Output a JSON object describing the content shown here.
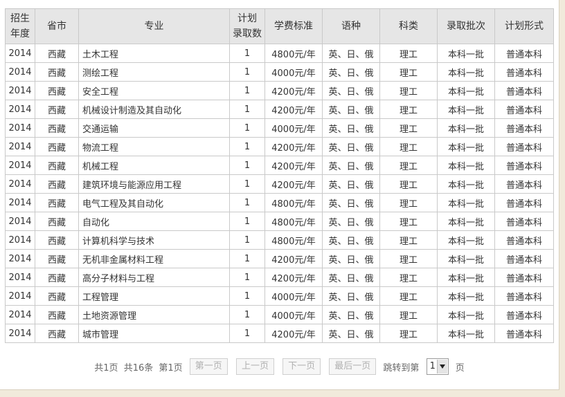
{
  "columns": [
    "招生\n年度",
    "省市",
    "专业",
    "计划\n录取数",
    "学费标准",
    "语种",
    "科类",
    "录取批次",
    "计划形式"
  ],
  "rows": [
    [
      "2014",
      "西藏",
      "土木工程",
      "1",
      "4800元/年",
      "英、日、俄",
      "理工",
      "本科一批",
      "普通本科"
    ],
    [
      "2014",
      "西藏",
      "测绘工程",
      "1",
      "4000元/年",
      "英、日、俄",
      "理工",
      "本科一批",
      "普通本科"
    ],
    [
      "2014",
      "西藏",
      "安全工程",
      "1",
      "4200元/年",
      "英、日、俄",
      "理工",
      "本科一批",
      "普通本科"
    ],
    [
      "2014",
      "西藏",
      "机械设计制造及其自动化",
      "1",
      "4200元/年",
      "英、日、俄",
      "理工",
      "本科一批",
      "普通本科"
    ],
    [
      "2014",
      "西藏",
      "交通运输",
      "1",
      "4000元/年",
      "英、日、俄",
      "理工",
      "本科一批",
      "普通本科"
    ],
    [
      "2014",
      "西藏",
      "物流工程",
      "1",
      "4200元/年",
      "英、日、俄",
      "理工",
      "本科一批",
      "普通本科"
    ],
    [
      "2014",
      "西藏",
      "机械工程",
      "1",
      "4200元/年",
      "英、日、俄",
      "理工",
      "本科一批",
      "普通本科"
    ],
    [
      "2014",
      "西藏",
      "建筑环境与能源应用工程",
      "1",
      "4200元/年",
      "英、日、俄",
      "理工",
      "本科一批",
      "普通本科"
    ],
    [
      "2014",
      "西藏",
      "电气工程及其自动化",
      "1",
      "4800元/年",
      "英、日、俄",
      "理工",
      "本科一批",
      "普通本科"
    ],
    [
      "2014",
      "西藏",
      "自动化",
      "1",
      "4800元/年",
      "英、日、俄",
      "理工",
      "本科一批",
      "普通本科"
    ],
    [
      "2014",
      "西藏",
      "计算机科学与技术",
      "1",
      "4800元/年",
      "英、日、俄",
      "理工",
      "本科一批",
      "普通本科"
    ],
    [
      "2014",
      "西藏",
      "无机非金属材料工程",
      "1",
      "4200元/年",
      "英、日、俄",
      "理工",
      "本科一批",
      "普通本科"
    ],
    [
      "2014",
      "西藏",
      "高分子材料与工程",
      "1",
      "4200元/年",
      "英、日、俄",
      "理工",
      "本科一批",
      "普通本科"
    ],
    [
      "2014",
      "西藏",
      "工程管理",
      "1",
      "4000元/年",
      "英、日、俄",
      "理工",
      "本科一批",
      "普通本科"
    ],
    [
      "2014",
      "西藏",
      "土地资源管理",
      "1",
      "4000元/年",
      "英、日、俄",
      "理工",
      "本科一批",
      "普通本科"
    ],
    [
      "2014",
      "西藏",
      "城市管理",
      "1",
      "4200元/年",
      "英、日、俄",
      "理工",
      "本科一批",
      "普通本科"
    ]
  ],
  "pagination": {
    "total_pages": "共1页",
    "total_records": "共16条",
    "current_page": "第1页",
    "first_label": "第一页",
    "prev_label": "上一页",
    "next_label": "下一页",
    "last_label": "最后一页",
    "jump_label": "跳转到第",
    "page_select_value": "1",
    "page_suffix": "页"
  }
}
